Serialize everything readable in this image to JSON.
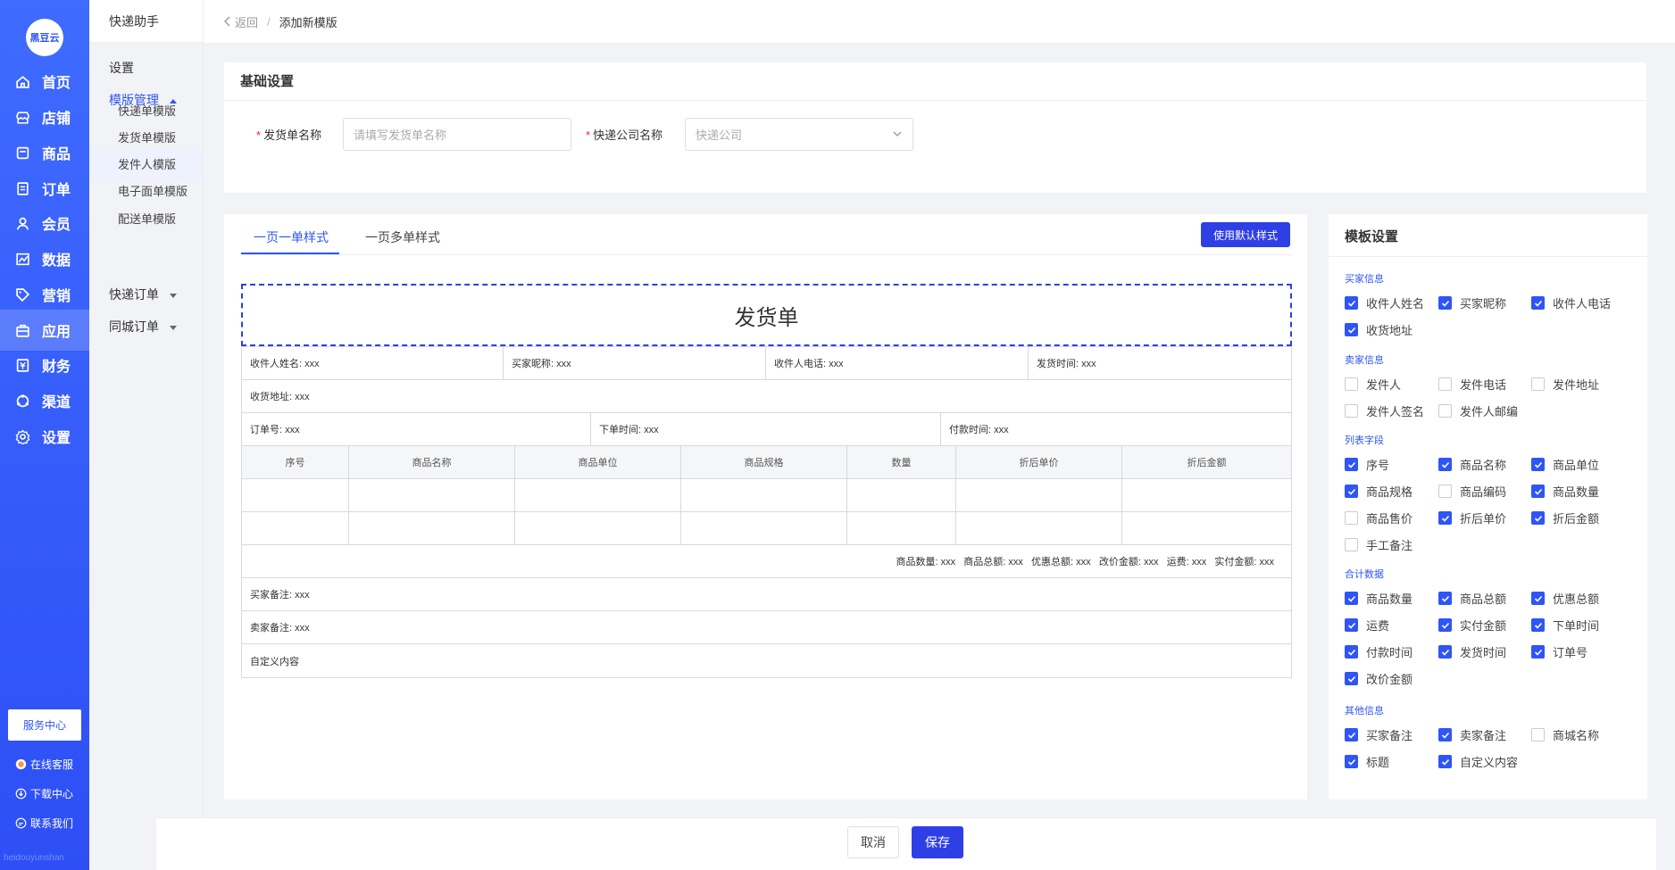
{
  "nav": {
    "logo_text": "黑豆云",
    "items": [
      {
        "label": "首页",
        "icon": "home-icon"
      },
      {
        "label": "店铺",
        "icon": "store-icon"
      },
      {
        "label": "商品",
        "icon": "goods-icon"
      },
      {
        "label": "订单",
        "icon": "order-icon"
      },
      {
        "label": "会员",
        "icon": "member-icon"
      },
      {
        "label": "数据",
        "icon": "chart-icon"
      },
      {
        "label": "营销",
        "icon": "tag-icon"
      },
      {
        "label": "应用",
        "icon": "app-icon"
      },
      {
        "label": "财务",
        "icon": "finance-icon"
      },
      {
        "label": "渠道",
        "icon": "channel-icon"
      },
      {
        "label": "设置",
        "icon": "gear-icon"
      }
    ],
    "active_item": "应用",
    "service_center": "服务中心",
    "online_service": "在线客服",
    "download_center": "下载中心",
    "contact_us": "联系我们",
    "brand_watermark": "heidouyunshan"
  },
  "subnav": {
    "title": "快递助手",
    "settings": "设置",
    "template_manage": "模版管理",
    "children": [
      "快递单模版",
      "发货单模版",
      "发件人模版",
      "电子面单模版",
      "配送单模版"
    ],
    "active_child": "发货单模版",
    "express_order": "快递订单",
    "city_order": "同城订单"
  },
  "breadcrumb": {
    "back": "返回",
    "separator": "/",
    "current": "添加新模版"
  },
  "basic": {
    "title": "基础设置",
    "name_label": "发货单名称",
    "name_placeholder": "请填写发货单名称",
    "company_label": "快递公司名称",
    "company_placeholder": "快递公司"
  },
  "preview": {
    "tabs": [
      "一页一单样式",
      "一页多单样式"
    ],
    "active_tab": "一页一单样式",
    "default_button": "使用默认样式",
    "doc_title": "发货单",
    "row1": [
      "收件人姓名: xxx",
      "买家昵称: xxx",
      "收件人电话: xxx",
      "发货时间: xxx"
    ],
    "address": "收货地址: xxx",
    "row3": [
      "订单号: xxx",
      "下单时间: xxx",
      "付款时间: xxx"
    ],
    "table_headers": [
      "序号",
      "商品名称",
      "商品单位",
      "商品规格",
      "数量",
      "折后单价",
      "折后金额"
    ],
    "summary": "商品数量: xxx   商品总额: xxx   优惠总额: xxx   改价金额: xxx   运费: xxx   实付金额: xxx",
    "buyer_note": "买家备注: xxx",
    "seller_note": "卖家备注: xxx",
    "custom": "自定义内容"
  },
  "settings": {
    "title": "模板设置",
    "groups": [
      {
        "name": "买家信息",
        "items": [
          {
            "label": "收件人姓名",
            "checked": true
          },
          {
            "label": "买家昵称",
            "checked": true
          },
          {
            "label": "收件人电话",
            "checked": true
          },
          {
            "label": "收货地址",
            "checked": true
          }
        ]
      },
      {
        "name": "卖家信息",
        "items": [
          {
            "label": "发件人",
            "checked": false
          },
          {
            "label": "发件电话",
            "checked": false
          },
          {
            "label": "发件地址",
            "checked": false
          },
          {
            "label": "发件人签名",
            "checked": false
          },
          {
            "label": "发件人邮编",
            "checked": false
          }
        ]
      },
      {
        "name": "列表字段",
        "items": [
          {
            "label": "序号",
            "checked": true
          },
          {
            "label": "商品名称",
            "checked": true
          },
          {
            "label": "商品单位",
            "checked": true
          },
          {
            "label": "商品规格",
            "checked": true
          },
          {
            "label": "商品编码",
            "checked": false
          },
          {
            "label": "商品数量",
            "checked": true
          },
          {
            "label": "商品售价",
            "checked": false
          },
          {
            "label": "折后单价",
            "checked": true
          },
          {
            "label": "折后金额",
            "checked": true
          },
          {
            "label": "手工备注",
            "checked": false
          }
        ]
      },
      {
        "name": "合计数据",
        "items": [
          {
            "label": "商品数量",
            "checked": true
          },
          {
            "label": "商品总额",
            "checked": true
          },
          {
            "label": "优惠总额",
            "checked": true
          },
          {
            "label": "运费",
            "checked": true
          },
          {
            "label": "实付金额",
            "checked": true
          },
          {
            "label": "下单时间",
            "checked": true
          },
          {
            "label": "付款时间",
            "checked": true
          },
          {
            "label": "发货时间",
            "checked": true
          },
          {
            "label": "订单号",
            "checked": true
          },
          {
            "label": "改价金额",
            "checked": true
          }
        ]
      },
      {
        "name": "其他信息",
        "items": [
          {
            "label": "买家备注",
            "checked": true
          },
          {
            "label": "卖家备注",
            "checked": true
          },
          {
            "label": "商城名称",
            "checked": false
          },
          {
            "label": "标题",
            "checked": true
          },
          {
            "label": "自定义内容",
            "checked": true
          }
        ]
      }
    ]
  },
  "footer": {
    "cancel": "取消",
    "save": "保存"
  },
  "colors": {
    "accent": "#2f55f6",
    "nav_bg": "#3a63fb",
    "required": "#f5222d"
  }
}
